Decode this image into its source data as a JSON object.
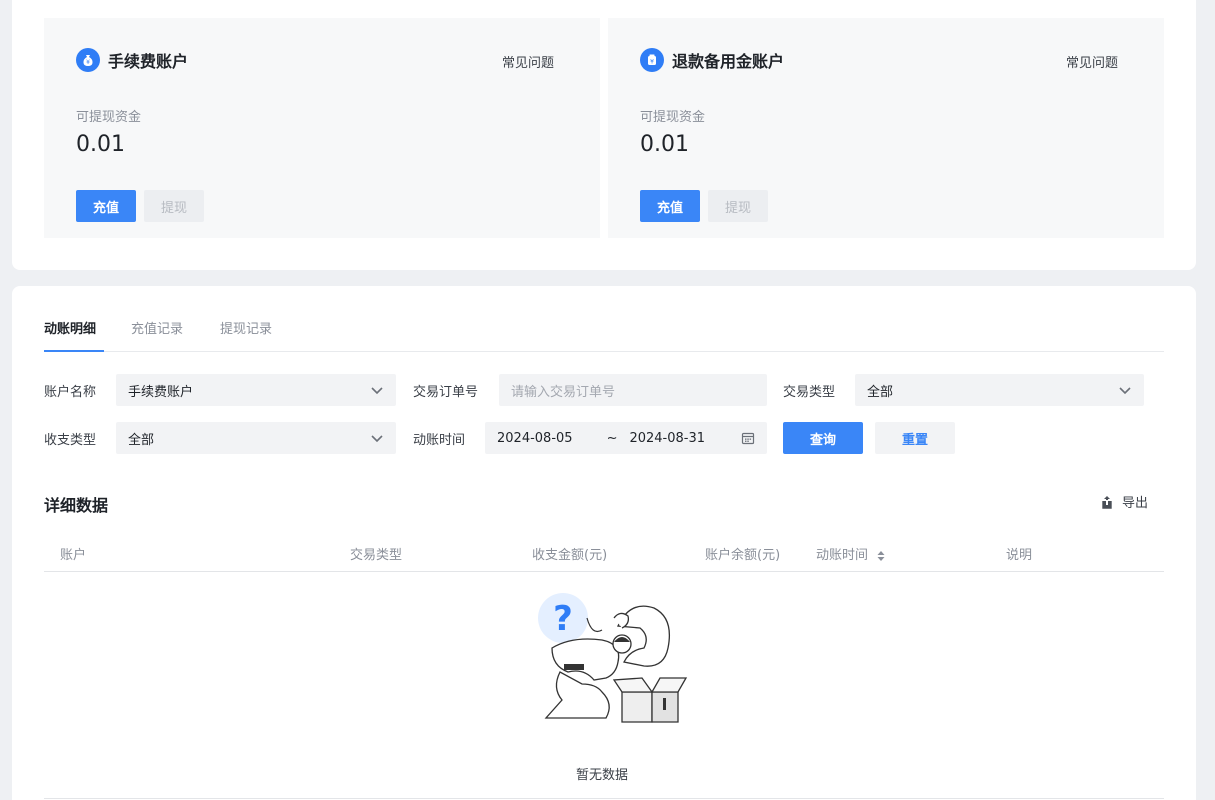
{
  "accounts": [
    {
      "title": "手续费账户",
      "faq": "常见问题",
      "avail_label": "可提现资金",
      "value": "0.01",
      "recharge": "充值",
      "withdraw": "提现",
      "icon": "money-bag-icon"
    },
    {
      "title": "退款备用金账户",
      "faq": "常见问题",
      "avail_label": "可提现资金",
      "value": "0.01",
      "recharge": "充值",
      "withdraw": "提现",
      "icon": "refund-icon"
    }
  ],
  "tabs": [
    {
      "label": "动账明细",
      "active": true
    },
    {
      "label": "充值记录",
      "active": false
    },
    {
      "label": "提现记录",
      "active": false
    }
  ],
  "filters": {
    "account_name": {
      "label": "账户名称",
      "value": "手续费账户"
    },
    "order_no": {
      "label": "交易订单号",
      "placeholder": "请输入交易订单号"
    },
    "trade_type": {
      "label": "交易类型",
      "value": "全部"
    },
    "income_type": {
      "label": "收支类型",
      "value": "全部"
    },
    "time": {
      "label": "动账时间",
      "start": "2024-08-05",
      "sep": "~",
      "end": "2024-08-31"
    },
    "search": "查询",
    "reset": "重置"
  },
  "detail": {
    "title": "详细数据",
    "export": "导出",
    "columns": [
      "账户",
      "交易类型",
      "收支金额(元)",
      "账户余额(元)",
      "动账时间",
      "说明"
    ],
    "empty_text": "暂无数据"
  },
  "colors": {
    "accent": "#3a86f7",
    "card_bg": "#f7f8f9"
  }
}
